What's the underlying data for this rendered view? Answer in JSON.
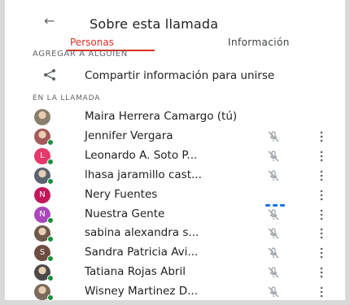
{
  "header": {
    "back_glyph": "←",
    "title": "Sobre esta llamada"
  },
  "tabs": [
    {
      "label": "Personas",
      "active": true
    },
    {
      "label": "Información",
      "active": false
    }
  ],
  "add_person_label": "AGREGAR A ALGUIEN",
  "share": {
    "label": "Compartir información para unirse",
    "icon": "share-icon"
  },
  "section_label": "EN LA LLAMADA",
  "participants": [
    {
      "name": "Maira Herrera Camargo (tú)",
      "avatar_type": "photo",
      "avatar_color": "#8a7f6e",
      "online": false,
      "mic": "none"
    },
    {
      "name": "Jennifer Vergara",
      "avatar_type": "photo",
      "avatar_color": "#a35a5a",
      "online": true,
      "mic": "muted"
    },
    {
      "name": "Leonardo A. Soto P...",
      "avatar_type": "letter",
      "letter": "L",
      "avatar_color": "#e5396b",
      "online": true,
      "mic": "muted"
    },
    {
      "name": "lhasa jaramillo cast...",
      "avatar_type": "photo",
      "avatar_color": "#5b6370",
      "online": true,
      "mic": "muted"
    },
    {
      "name": "Nery Fuentes",
      "avatar_type": "letter",
      "letter": "N",
      "avatar_color": "#c2185b",
      "online": false,
      "mic": "speaking"
    },
    {
      "name": "Nuestra Gente",
      "avatar_type": "letter",
      "letter": "N",
      "avatar_color": "#ab47bc",
      "online": true,
      "mic": "muted"
    },
    {
      "name": "sabina alexandra s...",
      "avatar_type": "photo",
      "avatar_color": "#6e5a4a",
      "online": true,
      "mic": "muted"
    },
    {
      "name": "Sandra Patricia Avi...",
      "avatar_type": "letter",
      "letter": "S",
      "avatar_color": "#6d4c41",
      "online": true,
      "mic": "muted"
    },
    {
      "name": "Tatiana Rojas Abril",
      "avatar_type": "photo",
      "avatar_color": "#4a4a4a",
      "online": true,
      "mic": "muted"
    },
    {
      "name": "Wisney Martinez D...",
      "avatar_type": "photo",
      "avatar_color": "#7a6a5a",
      "online": true,
      "mic": "muted"
    }
  ],
  "colors": {
    "accent": "#d93025",
    "speaking": "#1a73e8",
    "online": "#1e8e3e"
  }
}
